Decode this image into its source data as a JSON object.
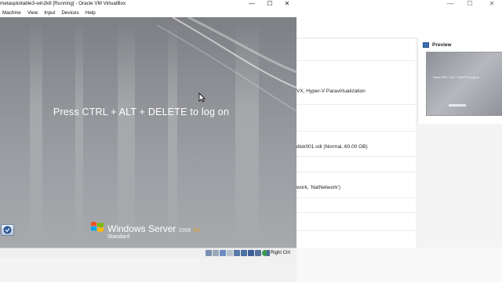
{
  "vm_window": {
    "title": "metasploitable3-win2k8 [Running] - Oracle VM VirtualBox",
    "controls": {
      "minimize": "—",
      "maximize": "☐",
      "close": "✕"
    },
    "menu": [
      "Machine",
      "View",
      "Input",
      "Devices",
      "Help"
    ],
    "screen": {
      "logon_prompt": "Press CTRL + ALT + DELETE to log on",
      "brand_name": "Windows Server",
      "brand_year": "2008",
      "brand_release": "R2",
      "edition": "Standard",
      "accessibility_icon": "ease-of-access-icon"
    },
    "status_bar": {
      "icons": [
        "hard-disk-icon",
        "optical-drive-icon",
        "audio-icon",
        "network-icon",
        "usb-icon",
        "shared-folders-icon",
        "display-icon",
        "video-capture-icon",
        "cpu-indicator-icon",
        "mouse-integration-icon",
        "keyboard-capture-icon"
      ],
      "host_key": "Right Ctrl"
    }
  },
  "manager": {
    "window_controls": {
      "minimize": "—",
      "maximize": "☐",
      "close": "✕"
    },
    "details": [
      "VX, Hyper-V Paravirtualization",
      "disk001.vdi (Normal, 60.00 GB)",
      "work, 'NatNetwork')"
    ],
    "preview": {
      "title": "Preview",
      "thumbnail_text": "Press CTRL + ALT + DELETE to log on"
    }
  },
  "colors": {
    "vm_screen": "#8d8f94",
    "release_accent": "#e5a12d",
    "status_bar": "#f0f0f0"
  }
}
